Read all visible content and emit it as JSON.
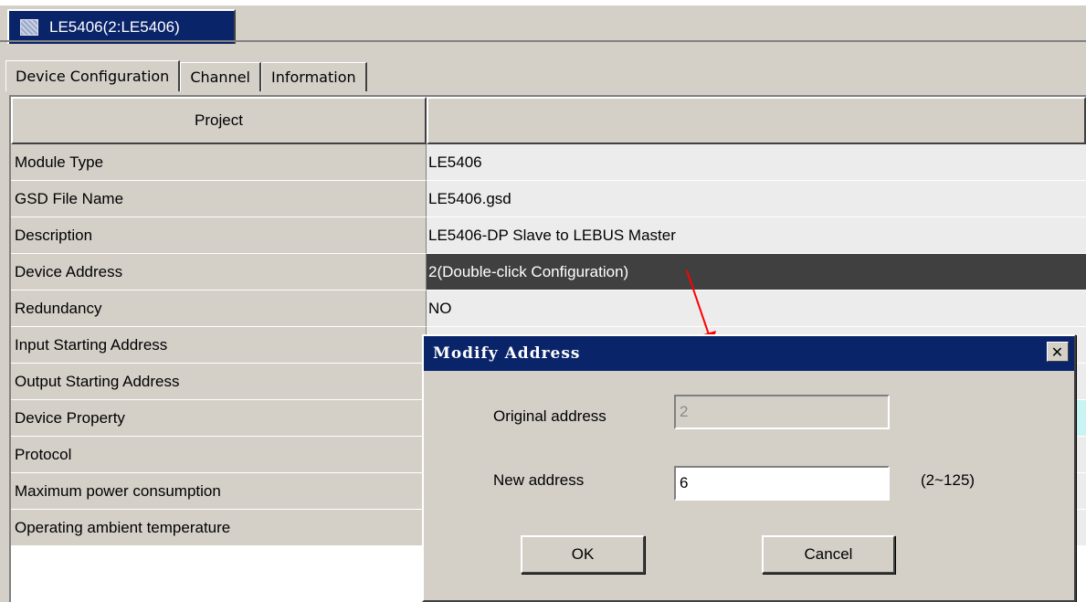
{
  "window_tab": {
    "label": "LE5406(2:LE5406)",
    "icon": "module-icon"
  },
  "tabs": [
    {
      "label": "Device Configuration"
    },
    {
      "label": "Channel"
    },
    {
      "label": "Information"
    }
  ],
  "grid": {
    "headers": {
      "project": "Project",
      "value": ""
    },
    "rows": [
      {
        "key": "Module Type",
        "value": "LE5406"
      },
      {
        "key": "GSD File Name",
        "value": "LE5406.gsd"
      },
      {
        "key": "Description",
        "value": "LE5406-DP Slave to LEBUS Master"
      },
      {
        "key": "Device Address",
        "value": "2(Double-click Configuration)"
      },
      {
        "key": "Redundancy",
        "value": "NO"
      },
      {
        "key": "Input Starting Address",
        "value": ""
      },
      {
        "key": "Output Starting Address",
        "value": ""
      },
      {
        "key": "Device Property",
        "value": ""
      },
      {
        "key": "Protocol",
        "value": ""
      },
      {
        "key": "Maximum power consumption",
        "value": ""
      },
      {
        "key": "Operating ambient temperature",
        "value": ""
      }
    ]
  },
  "dialog": {
    "title": "Modify Address",
    "close_glyph": "✕",
    "original_label": "Original address",
    "original_value": "2",
    "new_label": "New address",
    "new_value": "6",
    "range_hint": "(2~125)",
    "ok_label": "OK",
    "cancel_label": "Cancel"
  },
  "colors": {
    "title_bar": "#0a246a",
    "selected_row": "#404040",
    "arrow": "#ff0000"
  }
}
